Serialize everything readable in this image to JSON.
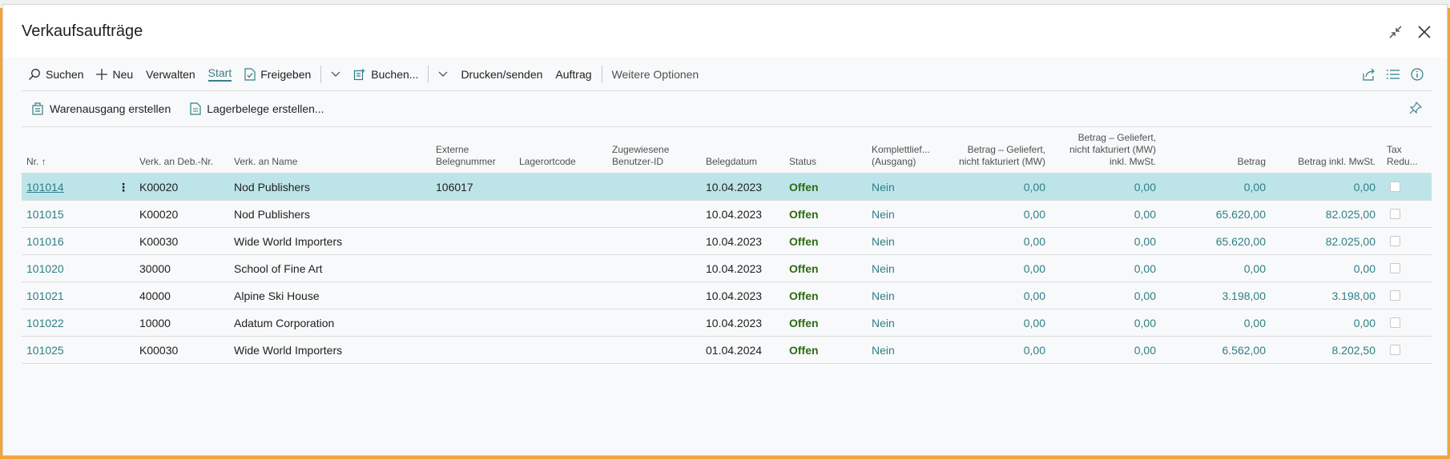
{
  "window": {
    "title": "Verkaufsaufträge"
  },
  "toolbar": {
    "search": "Suchen",
    "new": "Neu",
    "manage": "Verwalten",
    "start": "Start",
    "release": "Freigeben",
    "post": "Buchen...",
    "print_send": "Drucken/senden",
    "order": "Auftrag",
    "more_options": "Weitere Optionen"
  },
  "actions": {
    "create_shipment": "Warenausgang erstellen",
    "create_warehouse_docs": "Lagerbelege erstellen..."
  },
  "columns": {
    "nr": "Nr. ↑",
    "cust_no": "Verk. an Deb.-Nr.",
    "cust_name": "Verk. an Name",
    "ext_doc_1": "Externe",
    "ext_doc_2": "Belegnummer",
    "location": "Lagerortcode",
    "assigned_1": "Zugewiesene",
    "assigned_2": "Benutzer-ID",
    "doc_date": "Belegdatum",
    "status": "Status",
    "complete_1": "Komplettlief...",
    "complete_2": "(Ausgang)",
    "shipped_1": "Betrag – Geliefert,",
    "shipped_2": "nicht fakturiert (MW)",
    "shipped_vat_1": "Betrag – Geliefert,",
    "shipped_vat_2": "nicht fakturiert (MW)",
    "shipped_vat_3": "inkl. MwSt.",
    "amount": "Betrag",
    "amount_vat": "Betrag inkl. MwSt.",
    "tax_1": "Tax",
    "tax_2": "Redu..."
  },
  "rows": [
    {
      "nr": "101014",
      "cust_no": "K00020",
      "name": "Nod Publishers",
      "ext": "106017",
      "date": "10.04.2023",
      "status": "Offen",
      "complete": "Nein",
      "shipped": "0,00",
      "shipped_vat": "0,00",
      "amount": "0,00",
      "amount_vat": "0,00"
    },
    {
      "nr": "101015",
      "cust_no": "K00020",
      "name": "Nod Publishers",
      "ext": "",
      "date": "10.04.2023",
      "status": "Offen",
      "complete": "Nein",
      "shipped": "0,00",
      "shipped_vat": "0,00",
      "amount": "65.620,00",
      "amount_vat": "82.025,00"
    },
    {
      "nr": "101016",
      "cust_no": "K00030",
      "name": "Wide World Importers",
      "ext": "",
      "date": "10.04.2023",
      "status": "Offen",
      "complete": "Nein",
      "shipped": "0,00",
      "shipped_vat": "0,00",
      "amount": "65.620,00",
      "amount_vat": "82.025,00"
    },
    {
      "nr": "101020",
      "cust_no": "30000",
      "name": "School of Fine Art",
      "ext": "",
      "date": "10.04.2023",
      "status": "Offen",
      "complete": "Nein",
      "shipped": "0,00",
      "shipped_vat": "0,00",
      "amount": "0,00",
      "amount_vat": "0,00"
    },
    {
      "nr": "101021",
      "cust_no": "40000",
      "name": "Alpine Ski House",
      "ext": "",
      "date": "10.04.2023",
      "status": "Offen",
      "complete": "Nein",
      "shipped": "0,00",
      "shipped_vat": "0,00",
      "amount": "3.198,00",
      "amount_vat": "3.198,00"
    },
    {
      "nr": "101022",
      "cust_no": "10000",
      "name": "Adatum Corporation",
      "ext": "",
      "date": "10.04.2023",
      "status": "Offen",
      "complete": "Nein",
      "shipped": "0,00",
      "shipped_vat": "0,00",
      "amount": "0,00",
      "amount_vat": "0,00"
    },
    {
      "nr": "101025",
      "cust_no": "K00030",
      "name": "Wide World Importers",
      "ext": "",
      "date": "01.04.2024",
      "status": "Offen",
      "complete": "Nein",
      "shipped": "0,00",
      "shipped_vat": "0,00",
      "amount": "6.562,00",
      "amount_vat": "8.202,50"
    }
  ],
  "colors": {
    "accent": "#2f7f87",
    "selected_row": "#bde5e9",
    "status_open": "#2e6b12",
    "frame": "#f2a33a"
  }
}
